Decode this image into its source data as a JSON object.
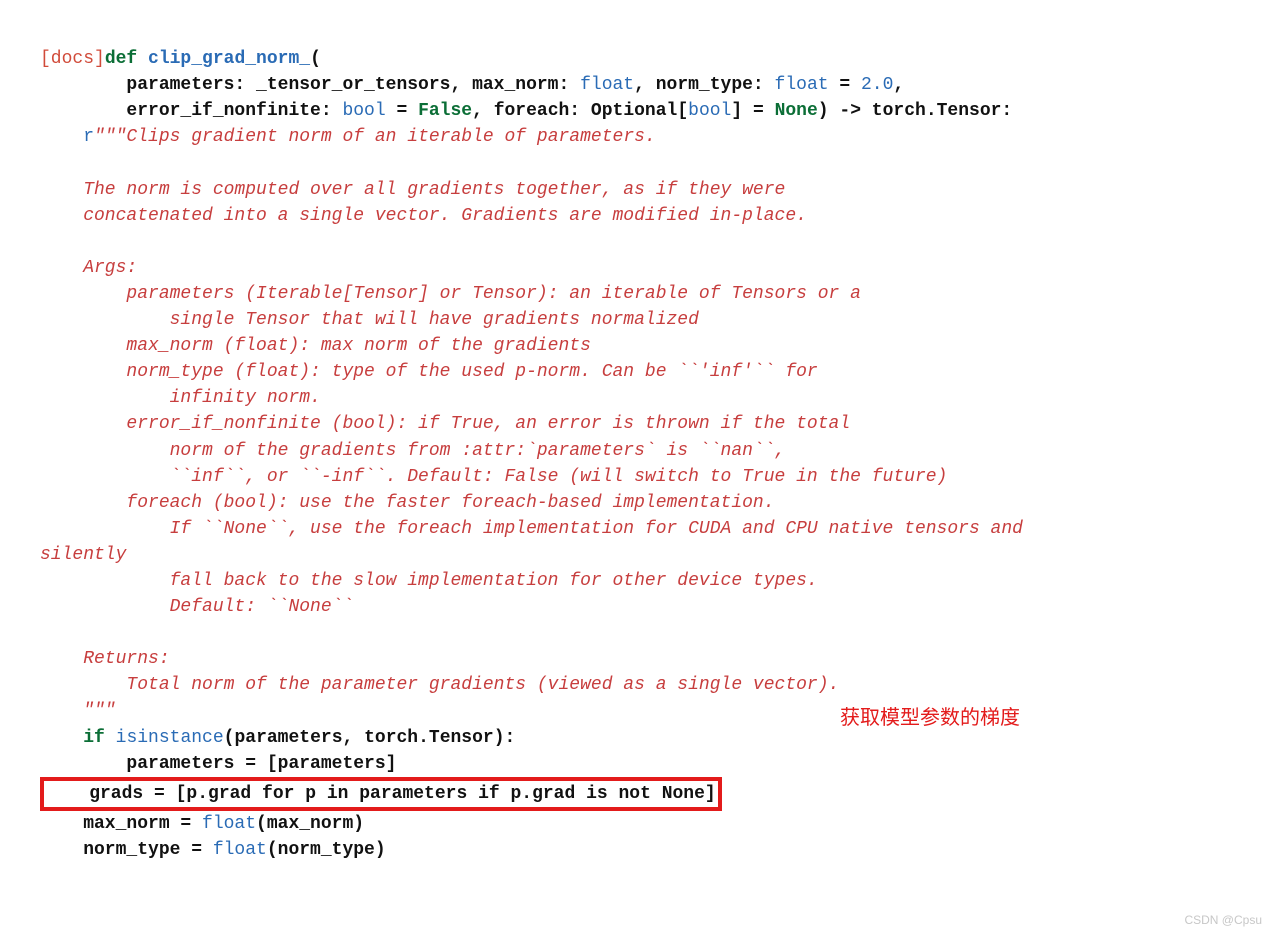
{
  "docs_label": "[docs]",
  "def_kw": "def",
  "func_name": "clip_grad_norm_",
  "sig_line1_a": "        parameters: _tensor_or_tensors, max_norm: ",
  "sig_float1": "float",
  "sig_line1_b": ", norm_type: ",
  "sig_float2": "float",
  "sig_line1_c": " = ",
  "sig_num": "2.0",
  "sig_line1_d": ",",
  "sig_line2_a": "        error_if_nonfinite: ",
  "sig_bool1": "bool",
  "sig_line2_b": " = ",
  "sig_false": "False",
  "sig_line2_c": ", foreach: Optional[",
  "sig_bool2": "bool",
  "sig_line2_d": "] = ",
  "sig_none": "None",
  "sig_line2_e": ") -> torch.Tensor:",
  "doc_prefix": "r",
  "doc_open": "\"\"\"Clips gradient norm of an iterable of parameters.",
  "doc_l1": "    The norm is computed over all gradients together, as if they were",
  "doc_l2": "    concatenated into a single vector. Gradients are modified in-place.",
  "doc_args": "    Args:",
  "doc_p1": "        parameters (Iterable[Tensor] or Tensor): an iterable of Tensors or a",
  "doc_p2": "            single Tensor that will have gradients normalized",
  "doc_p3": "        max_norm (float): max norm of the gradients",
  "doc_p4": "        norm_type (float): type of the used p-norm. Can be ``'inf'`` for",
  "doc_p5": "            infinity norm.",
  "doc_p6": "        error_if_nonfinite (bool): if True, an error is thrown if the total",
  "doc_p7": "            norm of the gradients from :attr:`parameters` is ``nan``,",
  "doc_p8": "            ``inf``, or ``-inf``. Default: False (will switch to True in the future)",
  "doc_p9": "        foreach (bool): use the faster foreach-based implementation.",
  "doc_p10a": "            If ``None``, use the foreach implementation for CUDA and CPU native tensors and ",
  "doc_p10b": "silently",
  "doc_p11": "            fall back to the slow implementation for other device types.",
  "doc_p12": "            Default: ``None``",
  "doc_ret": "    Returns:",
  "doc_ret1": "        Total norm of the parameter gradients (viewed as a single vector).",
  "doc_close": "    \"\"\"",
  "if_kw": "if",
  "isinstance_kw": "isinstance",
  "if_rest": "(parameters, torch.Tensor):",
  "params_assign": "        parameters = [parameters]",
  "grads_line": "    grads = [p.grad for p in parameters if p.grad is not None]",
  "maxnorm_a": "    max_norm = ",
  "float_kw1": "float",
  "maxnorm_b": "(max_norm)",
  "normtype_a": "    norm_type = ",
  "float_kw2": "float",
  "normtype_b": "(norm_type)",
  "annotation_text": "获取模型参数的梯度",
  "watermark_text": "CSDN @Cpsu"
}
